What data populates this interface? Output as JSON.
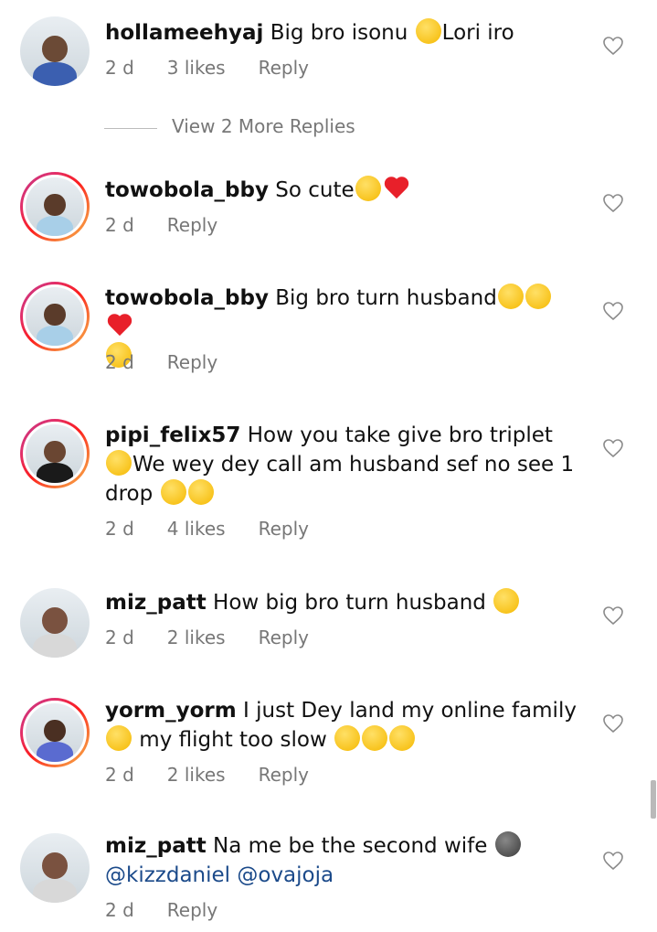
{
  "comments": [
    {
      "username": "hollameehyaj",
      "parts": [
        {
          "t": "Big bro isonu "
        },
        {
          "e": "yellow"
        },
        {
          "t": "Lori iro"
        }
      ],
      "time": "2 d",
      "likes": "3 likes",
      "reply": "Reply",
      "avatar": "plain",
      "skin": "#6b4a36",
      "shirt": "#3b5fb0"
    },
    {
      "username": "towobola_bby",
      "parts": [
        {
          "t": "So cute"
        },
        {
          "e": "yellow"
        },
        {
          "e": "heart"
        }
      ],
      "time": "2 d",
      "likes": "",
      "reply": "Reply",
      "avatar": "ring",
      "skin": "#5a3b2a",
      "shirt": "#a8cfe8"
    },
    {
      "username": "towobola_bby",
      "parts": [
        {
          "t": "Big bro turn husband"
        },
        {
          "e": "yellow"
        },
        {
          "e": "yellow"
        },
        {
          "e": "heart"
        },
        {
          "br": true
        },
        {
          "e": "yellow"
        }
      ],
      "time": "2 d",
      "likes": "",
      "reply": "Reply",
      "avatar": "ring",
      "skin": "#5a3b2a",
      "shirt": "#a8cfe8"
    },
    {
      "username": "pipi_felix57",
      "parts": [
        {
          "t": "How you take give bro triplet"
        },
        {
          "br": true
        },
        {
          "e": "yellow"
        },
        {
          "t": "We wey dey call am husband sef no see 1 drop "
        },
        {
          "e": "yellow"
        },
        {
          "e": "yellow"
        }
      ],
      "time": "2 d",
      "likes": "4 likes",
      "reply": "Reply",
      "avatar": "ring",
      "skin": "#6a4632",
      "shirt": "#1a1a1a"
    },
    {
      "username": "miz_patt",
      "parts": [
        {
          "t": "How big bro turn husband "
        },
        {
          "e": "yellow"
        }
      ],
      "time": "2 d",
      "likes": "2 likes",
      "reply": "Reply",
      "avatar": "plain",
      "skin": "#7a5240",
      "shirt": "#d8d8d8"
    },
    {
      "username": "yorm_yorm",
      "parts": [
        {
          "t": "I just Dey land my online family "
        },
        {
          "e": "yellow"
        },
        {
          "t": " my flight too slow "
        },
        {
          "e": "yellow"
        },
        {
          "e": "yellow"
        },
        {
          "e": "yellow"
        }
      ],
      "time": "2 d",
      "likes": "2 likes",
      "reply": "Reply",
      "avatar": "ring",
      "skin": "#4a2f22",
      "shirt": "#5a6bd0"
    },
    {
      "username": "miz_patt",
      "parts": [
        {
          "t": "Na me be the second wife "
        },
        {
          "e": "moon"
        },
        {
          "br": true
        },
        {
          "m": "@kizzdaniel"
        },
        {
          "t": " "
        },
        {
          "m": "@ovajoja"
        }
      ],
      "time": "2 d",
      "likes": "",
      "reply": "Reply",
      "avatar": "plain",
      "skin": "#7a5240",
      "shirt": "#d8d8d8"
    }
  ],
  "view_replies": "View 2 More Replies",
  "icons": {
    "like": "heart-outline-icon"
  },
  "colors": {
    "meta": "#777777",
    "mention": "#1b4a8a",
    "heart": "#e8202a"
  }
}
